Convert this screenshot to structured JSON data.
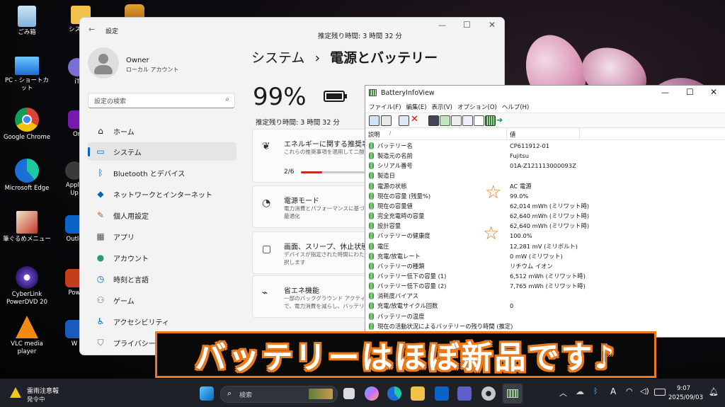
{
  "desktop": {
    "icons": [
      {
        "label": "ごみ箱",
        "icon": "recycle-bin-icon"
      },
      {
        "label": "システム",
        "icon": "system-folder-icon"
      },
      {
        "label": "",
        "icon": "mahjong-app-icon"
      },
      {
        "label": "PC - ショートカット",
        "icon": "pc-monitor-icon"
      },
      {
        "label": "iT",
        "icon": "app-icon"
      },
      {
        "label": "Google Chrome",
        "icon": "chrome-icon"
      },
      {
        "label": "On",
        "icon": "onenote-icon"
      },
      {
        "label": "Microsoft Edge",
        "icon": "edge-icon"
      },
      {
        "label": "Apple",
        "icon": "apple-app-icon"
      },
      {
        "label": "Up",
        "icon": ""
      },
      {
        "label": "筆ぐるめメニュー",
        "icon": "fudegurume-icon"
      },
      {
        "label": "Outlo",
        "icon": "outlook-icon"
      },
      {
        "label": "CyberLink PowerDVD 20",
        "icon": "powerdvd-icon"
      },
      {
        "label": "Pow",
        "icon": "powerpoint-icon"
      },
      {
        "label": "VLC media player",
        "icon": "vlc-icon"
      },
      {
        "label": "W",
        "icon": "word-icon"
      }
    ]
  },
  "settings": {
    "title": "設定",
    "remaining_top": "推定残り時間: 3 時間 32 分",
    "user": {
      "name": "Owner",
      "type": "ローカル アカウント"
    },
    "search_placeholder": "設定の検索",
    "breadcrumb_parent": "システム",
    "breadcrumb_sep": "›",
    "breadcrumb_current": "電源とバッテリー",
    "battery_percent": "99%",
    "battery_remaining": "推定残り時間: 3 時間 32 分",
    "nav": [
      {
        "label": "ホーム",
        "icon": "home-icon"
      },
      {
        "label": "システム",
        "icon": "system-icon",
        "selected": true
      },
      {
        "label": "Bluetooth とデバイス",
        "icon": "bluetooth-icon"
      },
      {
        "label": "ネットワークとインターネット",
        "icon": "wifi-icon"
      },
      {
        "label": "個人用設定",
        "icon": "brush-icon"
      },
      {
        "label": "アプリ",
        "icon": "apps-icon"
      },
      {
        "label": "アカウント",
        "icon": "account-icon"
      },
      {
        "label": "時刻と言語",
        "icon": "clock-icon"
      },
      {
        "label": "ゲーム",
        "icon": "gamepad-icon"
      },
      {
        "label": "アクセシビリティ",
        "icon": "accessibility-icon"
      },
      {
        "label": "プライバシーとセ",
        "icon": "shield-icon"
      }
    ],
    "cards": [
      {
        "title": "エネルギーに関する推奨事項",
        "sub": "これらの推奨事項を適用して二酸",
        "progress_label": "2/6",
        "progress": 0.33,
        "icon": "leaf-icon"
      },
      {
        "title": "電源モード",
        "sub": "電力消費とパフォーマンスに基づ",
        "sub2": "最適化",
        "icon": "gauge-icon"
      },
      {
        "title": "画面、スリープ、休止状態の",
        "sub": "デバイスが指定された時間にわた",
        "sub2": "択します",
        "icon": "screen-icon"
      },
      {
        "title": "省エネ機能",
        "sub": "一部のバックグラウンド アクティビ",
        "sub2": "で、電力消費を減らし、バッテリ",
        "icon": "battery-saver-icon"
      }
    ],
    "accent": "#0067c0"
  },
  "biv": {
    "title": "BatteryInfoView",
    "menu": [
      "ファイル(F)",
      "編集(E)",
      "表示(V)",
      "オプション(O)",
      "ヘルプ(H)"
    ],
    "col1": "説明",
    "col1_sort": "/",
    "col2": "値",
    "rows": [
      {
        "k": "バッテリー名",
        "v": "CP611912-01"
      },
      {
        "k": "製造元の名前",
        "v": "Fujitsu"
      },
      {
        "k": "シリアル番号",
        "v": "01A-Z121113000093Z"
      },
      {
        "k": "製造日",
        "v": ""
      },
      {
        "k": "電源の状態",
        "v": "AC 電源"
      },
      {
        "k": "現在の容量 (残量%)",
        "v": "99.0%"
      },
      {
        "k": "現在の容量値",
        "v": "62,014 mWh (ミリワット時)"
      },
      {
        "k": "完全充電時の容量",
        "v": "62,640 mWh (ミリワット時)"
      },
      {
        "k": "設計容量",
        "v": "62,640 mWh (ミリワット時)"
      },
      {
        "k": "バッテリーの健康度",
        "v": "100.0%"
      },
      {
        "k": "電圧",
        "v": "12,281 mV (ミリボルト)"
      },
      {
        "k": "充電/放電レート",
        "v": "0 mW (ミリワット)"
      },
      {
        "k": "バッテリーの種類",
        "v": "リチウム イオン"
      },
      {
        "k": "バッテリー低下の容量 (1)",
        "v": "6,512 mWh (ミリワット時)"
      },
      {
        "k": "バッテリー低下の容量 (2)",
        "v": "7,765 mWh (ミリワット時)"
      },
      {
        "k": "消耗度バイアス",
        "v": ""
      },
      {
        "k": "充電/放電サイクル回数",
        "v": "0"
      },
      {
        "k": "バッテリーの温度",
        "v": ""
      },
      {
        "k": "現在の活動状況によるバッテリーの残り時間 (推定)",
        "v": ""
      }
    ],
    "star_symbol": "☆"
  },
  "banner": {
    "text": "バッテリーはほぼ新品です♪"
  },
  "taskbar": {
    "weather_title": "雷雨注意報",
    "weather_sub": "発令中",
    "search_label": "検索",
    "time": "9:07",
    "date": "2025/09/03",
    "ime": "A"
  }
}
